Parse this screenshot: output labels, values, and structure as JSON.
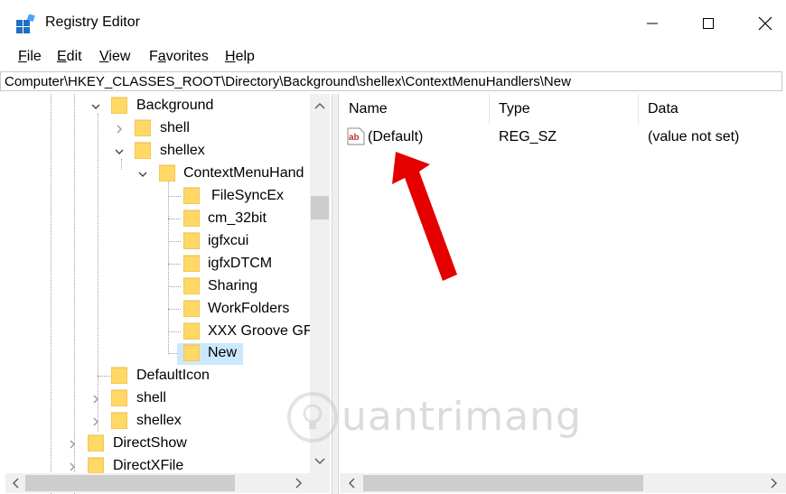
{
  "window": {
    "title": "Registry Editor"
  },
  "menu": [
    {
      "key": "F",
      "rest": "ile"
    },
    {
      "key": "E",
      "rest": "dit"
    },
    {
      "key": "V",
      "rest": "iew"
    },
    {
      "key": "a",
      "pre": "F",
      "rest": "vorites"
    },
    {
      "key": "H",
      "rest": "elp"
    }
  ],
  "address": "Computer\\HKEY_CLASSES_ROOT\\Directory\\Background\\shellex\\ContextMenuHandlers\\New",
  "tree": {
    "background": "Background",
    "shell": "shell",
    "shellex": "shellex",
    "contextmenu": "ContextMenuHand",
    "filesyncex": "FileSyncEx",
    "cm32bit": "cm_32bit",
    "igfxcui": "igfxcui",
    "igfxdtcm": "igfxDTCM",
    "sharing": "Sharing",
    "workfolders": "WorkFolders",
    "groove": "XXX Groove GFS",
    "new": "New",
    "defaulticon": "DefaultIcon",
    "shell2": "shell",
    "shellex2": "shellex",
    "directshow": "DirectShow",
    "directxfile": "DirectXFile"
  },
  "list": {
    "columns": [
      "Name",
      "Type",
      "Data"
    ],
    "rows": [
      {
        "name": "(Default)",
        "type": "REG_SZ",
        "data": "(value not set)"
      }
    ]
  },
  "watermark": "uantrimang",
  "colors": {
    "selection": "#cce8ff",
    "folder": "#ffd866",
    "arrow": "#e50000"
  }
}
